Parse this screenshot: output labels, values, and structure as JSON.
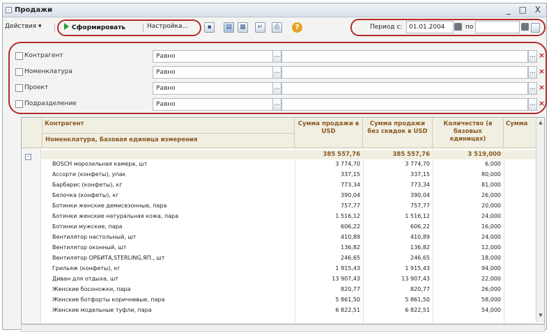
{
  "window": {
    "title": "Продажи",
    "controls": "_ □ X"
  },
  "toolbar": {
    "actions_label": "Действия ▾",
    "generate_label": "Сформировать",
    "settings_label": "Настройка...",
    "help_label": "?",
    "period_from_label": "Период с:",
    "period_from_value": "01.01.2004",
    "period_to_label": "по",
    "period_to_value": ""
  },
  "filters": [
    {
      "name": "Контрагент",
      "condition": "Равно",
      "value": ""
    },
    {
      "name": "Номенклатура",
      "condition": "Равно",
      "value": ""
    },
    {
      "name": "Проект",
      "condition": "Равно",
      "value": ""
    },
    {
      "name": "Подразделение",
      "condition": "Равно",
      "value": ""
    }
  ],
  "table": {
    "header": {
      "group1": "Контрагент",
      "group2": "Номенклатура, Базовая единица измерения",
      "col_sum_usd": "Сумма продажи в USD",
      "col_sum_nodisc": "Сумма продажи без скидок в USD",
      "col_qty": "Количество (в базовых единицах)",
      "col_more": "Сумма"
    },
    "total": {
      "sum_usd": "385 557,76",
      "sum_nodisc": "385 557,76",
      "qty": "3 519,000"
    },
    "rows": [
      {
        "name": "BOSCH морозильная камера, шт",
        "sum_usd": "3 774,70",
        "sum_nodisc": "3 774,70",
        "qty": "6,000"
      },
      {
        "name": "Ассорти (конфеты), упак",
        "sum_usd": "337,15",
        "sum_nodisc": "337,15",
        "qty": "80,000"
      },
      {
        "name": "Барбарис (конфеты), кг",
        "sum_usd": "773,34",
        "sum_nodisc": "773,34",
        "qty": "81,000"
      },
      {
        "name": "Белочка (конфеты), кг",
        "sum_usd": "390,04",
        "sum_nodisc": "390,04",
        "qty": "26,000"
      },
      {
        "name": "Ботинки женские демисезонные, пара",
        "sum_usd": "757,77",
        "sum_nodisc": "757,77",
        "qty": "20,000"
      },
      {
        "name": "Ботинки женские натуральная кожа, пара",
        "sum_usd": "1 516,12",
        "sum_nodisc": "1 516,12",
        "qty": "24,000"
      },
      {
        "name": "Ботинки мужские, пара",
        "sum_usd": "606,22",
        "sum_nodisc": "606,22",
        "qty": "16,000"
      },
      {
        "name": "Вентилятор настольный, шт",
        "sum_usd": "410,89",
        "sum_nodisc": "410,89",
        "qty": "24,000"
      },
      {
        "name": "Вентилятор оконный, шт",
        "sum_usd": "136,82",
        "sum_nodisc": "136,82",
        "qty": "12,000"
      },
      {
        "name": "Вентилятор ОРБИТА,STERLING,ЯП., шт",
        "sum_usd": "246,65",
        "sum_nodisc": "246,65",
        "qty": "18,000"
      },
      {
        "name": "Грильяж (конфеты), кг",
        "sum_usd": "1 915,43",
        "sum_nodisc": "1 915,43",
        "qty": "94,000"
      },
      {
        "name": "Диван для отдыха, шт",
        "sum_usd": "13 907,43",
        "sum_nodisc": "13 907,43",
        "qty": "22,000"
      },
      {
        "name": "Женские босоножки, пара",
        "sum_usd": "820,77",
        "sum_nodisc": "820,77",
        "qty": "26,000"
      },
      {
        "name": "Женские ботфорты коричневые, пара",
        "sum_usd": "5 861,50",
        "sum_nodisc": "5 861,50",
        "qty": "58,000"
      },
      {
        "name": "Женские модельные туфли, пара",
        "sum_usd": "6 822,51",
        "sum_nodisc": "6 822,51",
        "qty": "54,000"
      }
    ]
  }
}
